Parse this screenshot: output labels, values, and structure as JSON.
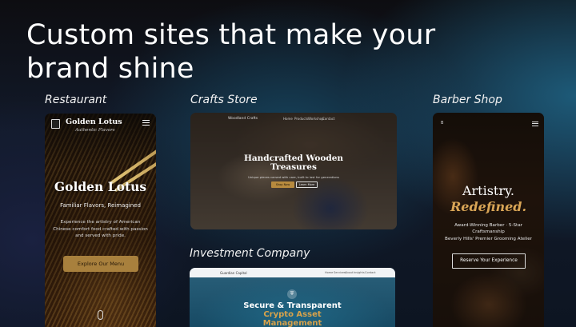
{
  "headline": {
    "line1": "Custom sites that make your",
    "line2": "brand shine"
  },
  "showcase": {
    "restaurant": {
      "label": "Restaurant",
      "brand": "Golden Lotus",
      "brand_sub": "Authentic Flavors",
      "hero_title": "Golden Lotus",
      "hero_tagline": "Familiar Flavors, Reimagined",
      "hero_description": "Experience the artistry of American Chinese comfort food crafted with passion and served with pride.",
      "cta": "Explore Our Menu"
    },
    "crafts": {
      "label": "Crafts Store",
      "logo": "Woodland Crafts",
      "nav": [
        "Home",
        "Products",
        "Workshop",
        "Contact"
      ],
      "hero_title_1": "Handcrafted Wooden",
      "hero_title_2": "Treasures",
      "hero_sub": "Unique pieces carved with care, built to last for generations",
      "cta_primary": "Shop Now",
      "cta_secondary": "Learn More"
    },
    "investment": {
      "label": "Investment Company",
      "logo": "Guardian Capital",
      "nav": [
        "Home",
        "Services",
        "About",
        "Insights",
        "Contact"
      ],
      "hero_title_1": "Secure & Transparent",
      "hero_title_2": "Crypto Asset",
      "hero_title_3": "Management"
    },
    "barber": {
      "label": "Barber Shop",
      "logo": "B",
      "hero_title_1": "Artistry.",
      "hero_title_2": "Redefined.",
      "line1": "Award-Winning Barber · 5-Star",
      "line2": "Craftsmanship",
      "line3": "Beverly Hills' Premier Grooming Atelier",
      "cta": "Reserve Your Experience"
    }
  },
  "colors": {
    "restaurant_accent": "#a8803d",
    "barber_accent": "#d9a556",
    "investment_accent": "#d7a24b"
  }
}
